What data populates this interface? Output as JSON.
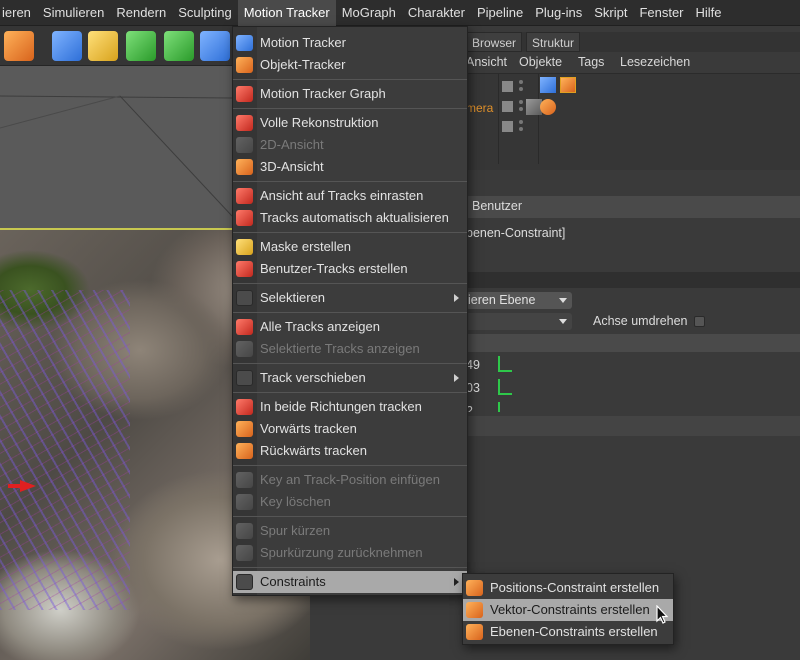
{
  "menubar": {
    "items": [
      "ieren",
      "Simulieren",
      "Rendern",
      "Sculpting",
      "Motion Tracker",
      "MoGraph",
      "Charakter",
      "Pipeline",
      "Plug-ins",
      "Skript",
      "Fenster",
      "Hilfe"
    ],
    "active_index": 4
  },
  "toolbar": {
    "icons": [
      "render-icon",
      "cube-icon",
      "pen-icon",
      "subdivide-icon",
      "cloner-icon",
      "deformer-icon"
    ]
  },
  "right_panel": {
    "tabs": [
      "Browser",
      "Struktur"
    ],
    "object_header": [
      "Ansicht",
      "Objekte",
      "Tags",
      "Lesezeichen"
    ],
    "object_name_fragment": "mera",
    "attr_tab": "Benutzer",
    "attr_name": "benen-Constraint]",
    "select_value": "ieren Ebene",
    "axis_label": "Achse umdrehen",
    "num_values": [
      "49",
      "03",
      "2"
    ]
  },
  "menu": {
    "items": [
      {
        "label": "Motion Tracker",
        "icon": "motion-tracker-icon",
        "color": "c-blue",
        "disabled": false,
        "submenu": false
      },
      {
        "label": "Objekt-Tracker",
        "icon": "object-tracker-icon",
        "color": "c-orange",
        "disabled": false,
        "submenu": false
      },
      {
        "sep": true
      },
      {
        "label": "Motion Tracker Graph",
        "icon": "tracker-graph-icon",
        "color": "c-red",
        "disabled": false,
        "submenu": false
      },
      {
        "sep": true
      },
      {
        "label": "Volle Rekonstruktion",
        "icon": "reconstruction-icon",
        "color": "c-red",
        "disabled": false,
        "submenu": false
      },
      {
        "label": "2D-Ansicht",
        "icon": "view-2d-icon",
        "color": "c-gray",
        "disabled": true,
        "submenu": false
      },
      {
        "label": "3D-Ansicht",
        "icon": "view-3d-icon",
        "color": "c-orange",
        "disabled": false,
        "submenu": false
      },
      {
        "sep": true
      },
      {
        "label": "Ansicht auf Tracks einrasten",
        "icon": "snap-tracks-icon",
        "color": "c-red",
        "disabled": false,
        "submenu": false
      },
      {
        "label": "Tracks automatisch aktualisieren",
        "icon": "auto-update-icon",
        "color": "c-red",
        "disabled": false,
        "submenu": false
      },
      {
        "sep": true
      },
      {
        "label": "Maske erstellen",
        "icon": "mask-icon",
        "color": "c-yellow",
        "disabled": false,
        "submenu": false
      },
      {
        "label": "Benutzer-Tracks erstellen",
        "icon": "user-tracks-icon",
        "color": "c-red",
        "disabled": false,
        "submenu": false
      },
      {
        "sep": true
      },
      {
        "label": "Selektieren",
        "icon": "",
        "color": "c-dark",
        "disabled": false,
        "submenu": true
      },
      {
        "sep": true
      },
      {
        "label": "Alle Tracks anzeigen",
        "icon": "show-all-tracks-icon",
        "color": "c-red",
        "disabled": false,
        "submenu": false
      },
      {
        "label": "Selektierte Tracks anzeigen",
        "icon": "show-selected-tracks-icon",
        "color": "c-gray",
        "disabled": true,
        "submenu": false
      },
      {
        "sep": true
      },
      {
        "label": "Track verschieben",
        "icon": "",
        "color": "c-dark",
        "disabled": false,
        "submenu": true
      },
      {
        "sep": true
      },
      {
        "label": "In beide Richtungen tracken",
        "icon": "track-both-icon",
        "color": "c-red",
        "disabled": false,
        "submenu": false
      },
      {
        "label": "Vorwärts tracken",
        "icon": "track-forward-icon",
        "color": "c-orange",
        "disabled": false,
        "submenu": false
      },
      {
        "label": "Rückwärts tracken",
        "icon": "track-backward-icon",
        "color": "c-orange",
        "disabled": false,
        "submenu": false
      },
      {
        "sep": true
      },
      {
        "label": "Key an Track-Position einfügen",
        "icon": "insert-key-icon",
        "color": "c-gray",
        "disabled": true,
        "submenu": false
      },
      {
        "label": "Key löschen",
        "icon": "delete-key-icon",
        "color": "c-gray",
        "disabled": true,
        "submenu": false
      },
      {
        "sep": true
      },
      {
        "label": "Spur kürzen",
        "icon": "trim-track-icon",
        "color": "c-gray",
        "disabled": true,
        "submenu": false
      },
      {
        "label": "Spurkürzung zurücknehmen",
        "icon": "undo-trim-icon",
        "color": "c-gray",
        "disabled": true,
        "submenu": false
      },
      {
        "sep": true
      },
      {
        "label": "Constraints",
        "icon": "",
        "color": "c-dark",
        "disabled": false,
        "submenu": true,
        "highlight": true
      }
    ]
  },
  "submenu": {
    "items": [
      {
        "label": "Positions-Constraint erstellen",
        "icon": "position-constraint-icon",
        "color": "c-orange",
        "highlight": false
      },
      {
        "label": "Vektor-Constraints erstellen",
        "icon": "vector-constraint-icon",
        "color": "c-orange",
        "highlight": true
      },
      {
        "label": "Ebenen-Constraints erstellen",
        "icon": "plane-constraint-icon",
        "color": "c-orange",
        "highlight": false
      }
    ]
  }
}
